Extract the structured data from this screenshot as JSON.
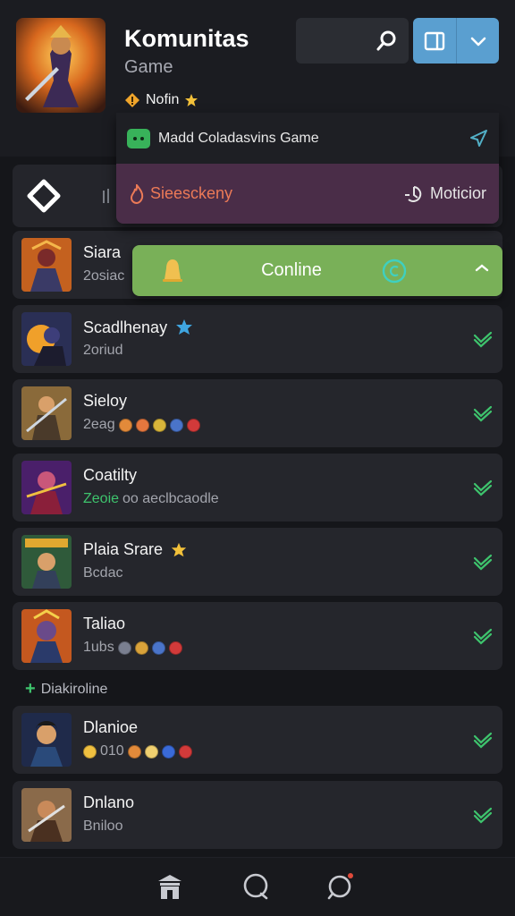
{
  "header": {
    "title": "Komunitas",
    "subtitle": "Game",
    "notif_label": "Nofin"
  },
  "dropdown": {
    "item1_label": "Madd Coladasvins Game",
    "item2_label": "Sieesckeny",
    "item3_label": "Moticior"
  },
  "online_banner": {
    "label": "Conline"
  },
  "section": {
    "label": "Diakiroline"
  },
  "friends": [
    {
      "name": "Siara",
      "status": "2osiac",
      "checked": false
    },
    {
      "name": "Scadlhenay",
      "status": "2oriud",
      "checked": true
    },
    {
      "name": "Sieloy",
      "status": "2eag",
      "checked": true
    },
    {
      "name": "Coatilty",
      "status_green": "Zeoie",
      "status": "oo aeclbcaodle",
      "checked": true
    },
    {
      "name": "Plaia Srare",
      "status": "Bcdac",
      "checked": true
    },
    {
      "name": "Taliao",
      "status": "1ubs",
      "checked": true
    },
    {
      "name": "Dlanioe",
      "status": "010",
      "checked": true
    },
    {
      "name": "Dnlano",
      "status": "Bniloo",
      "checked": true
    }
  ],
  "colors": {
    "background": "#15161a",
    "row_background": "#25262c",
    "online_green": "#79b058",
    "subscribe_purple": "#4a2d48",
    "action_blue": "#5a9fd0",
    "check_green": "#3ec46d",
    "subscribe_orange": "#ec7a57"
  },
  "icons": {
    "search": "search-icon",
    "window": "window-icon",
    "chevron": "chevron-down-icon",
    "bell": "bell-icon",
    "refresh": "refresh-icon",
    "send": "send-icon",
    "home": "home-icon",
    "chat": "chat-icon",
    "notifications": "notification-chat-icon"
  }
}
